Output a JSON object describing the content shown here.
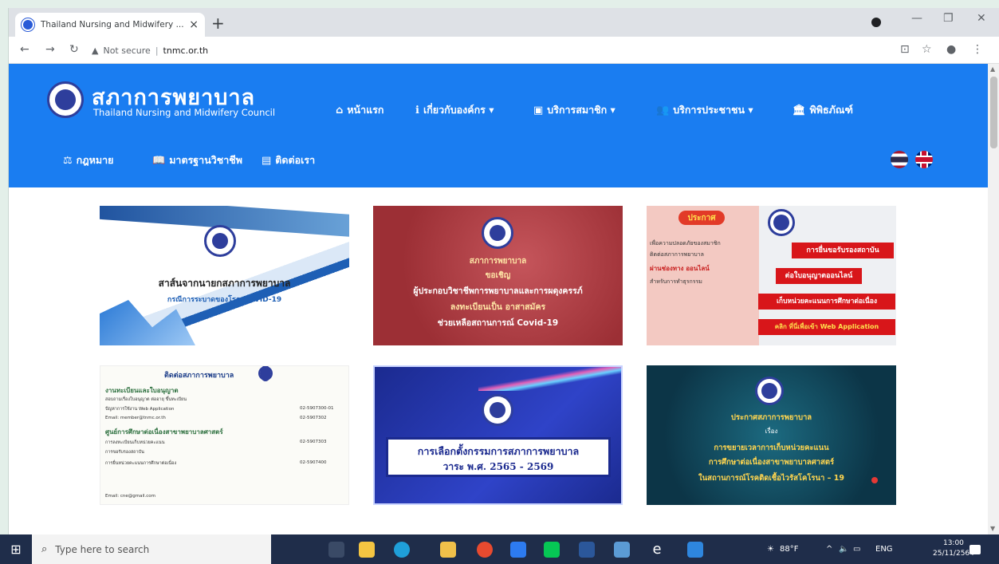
{
  "browser": {
    "tab_title": "Thailand Nursing and Midwifery ...",
    "tab_close": "×",
    "new_tab": "+",
    "security_label": "Not secure",
    "url": "tnmc.or.th",
    "min": "—",
    "max": "❐",
    "close": "✕"
  },
  "site": {
    "logo_th": "สภาการพยาบาล",
    "logo_en": "Thailand Nursing and Midwifery Council",
    "nav": {
      "home": "หน้าแรก",
      "about": "เกี่ยวกับองค์กร ▾",
      "member": "บริการสมาชิก ▾",
      "public": "บริการประชาชน ▾",
      "museum": "พิพิธภัณฑ์",
      "law": "กฎหมาย",
      "standard": "มาตรฐานวิชาชีพ",
      "contact": "ติดต่อเรา"
    }
  },
  "cards": {
    "c1": {
      "line1": "สาส์นจากนายกสภาการพยาบาล",
      "line2": "กรณีการระบาดของโรค COVID-19"
    },
    "c2": {
      "line1": "สภาการพยาบาล",
      "line2": "ขอเชิญ",
      "line3": "ผู้ประกอบวิชาชีพการพยาบาลและการผดุงครรภ์",
      "line4": "ลงทะเบียนเป็น อาสาสมัคร",
      "line5": "ช่วยเหลือสถานการณ์ Covid-19"
    },
    "c3": {
      "title": "ประกาศ",
      "left1": "เพื่อความปลอดภัยของสมาชิก",
      "left2": "ติดต่อสภาการพยาบาล",
      "left3": "ผ่านช่องทาง ออนไลน์",
      "left4": "สำหรับการทำธุรกรรม",
      "btn1": "การยื่นขอรับรองสถาบัน",
      "btn2": "ต่อใบอนุญาตออนไลน์",
      "btn3": "เก็บหน่วยคะแนนการศึกษาต่อเนื่อง",
      "btn4": "คลิก ที่นี่เพื่อเข้า Web Application"
    },
    "c4": {
      "title": "ติดต่อสภาการพยาบาล",
      "sec1": "งานทะเบียนและใบอนุญาต",
      "r1": "สอบถามเรื่องใบอนุญาต ต่ออายุ ขึ้นทะเบียน",
      "r2": "ปัญหาการใช้งาน Web Application",
      "r3": "Email: member@tnmc.or.th",
      "sec2": "ศูนย์การศึกษาต่อเนื่องสาขาพยาบาลศาสตร์",
      "r4": "การลงทะเบียนเก็บหน่วยคะแนน",
      "r5": "การขอรับรองสถาบัน",
      "r6": "การยื่นหน่วยคะแนนการศึกษาต่อเนื่อง",
      "r7": "Email: cne@gmail.com",
      "n1": "02-5907300-01",
      "n2": "02-5907302",
      "n3": "02-5907303",
      "n4": "02-5907400"
    },
    "c5": {
      "line1": "การเลือกตั้งกรรมการสภาการพยาบาล",
      "line2": "วาระ พ.ศ. 2565 - 2569"
    },
    "c6": {
      "line1": "ประกาศสภาการพยาบาล",
      "line2": "เรื่อง",
      "line3": "การขยายเวลาการเก็บหน่วยคะแนน",
      "line4": "การศึกษาต่อเนื่องสาขาพยาบาลศาสตร์",
      "line5": "ในสถานการณ์โรคติดเชื้อไวรัสโคโรนา – 19"
    }
  },
  "taskbar": {
    "search_placeholder": "Type here to search",
    "weather": "88°F",
    "lang": "ENG",
    "time": "13:00",
    "date": "25/11/2564"
  }
}
